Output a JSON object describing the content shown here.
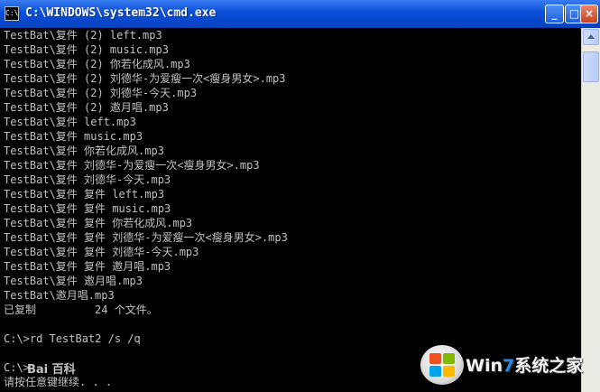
{
  "window": {
    "icon_label": "C:\\",
    "title": "C:\\WINDOWS\\system32\\cmd.exe",
    "minimize_label": "_",
    "maximize_label": "□",
    "close_label": "×"
  },
  "console_lines": [
    "TestBat\\复件 (2) left.mp3",
    "TestBat\\复件 (2) music.mp3",
    "TestBat\\复件 (2) 你若化成风.mp3",
    "TestBat\\复件 (2) 刘德华-为爱瘦一次<瘦身男女>.mp3",
    "TestBat\\复件 (2) 刘德华-今天.mp3",
    "TestBat\\复件 (2) 邀月唱.mp3",
    "TestBat\\复件 left.mp3",
    "TestBat\\复件 music.mp3",
    "TestBat\\复件 你若化成风.mp3",
    "TestBat\\复件 刘德华-为爱瘦一次<瘦身男女>.mp3",
    "TestBat\\复件 刘德华-今天.mp3",
    "TestBat\\复件 复件 left.mp3",
    "TestBat\\复件 复件 music.mp3",
    "TestBat\\复件 复件 你若化成风.mp3",
    "TestBat\\复件 复件 刘德华-为爱瘦一次<瘦身男女>.mp3",
    "TestBat\\复件 复件 刘德华-今天.mp3",
    "TestBat\\复件 复件 邀月唱.mp3",
    "TestBat\\复件 邀月唱.mp3",
    "TestBat\\邀月唱.mp3",
    "已复制         24 个文件。",
    "",
    "C:\\>rd TestBat2 /s /q",
    "",
    "C:\\>",
    "请按任意键继续. . ."
  ],
  "watermarks": {
    "baidu": "Bai 百科",
    "win7_prefix": "Win",
    "win7_seven": "7",
    "win7_suffix": "系统之家"
  }
}
